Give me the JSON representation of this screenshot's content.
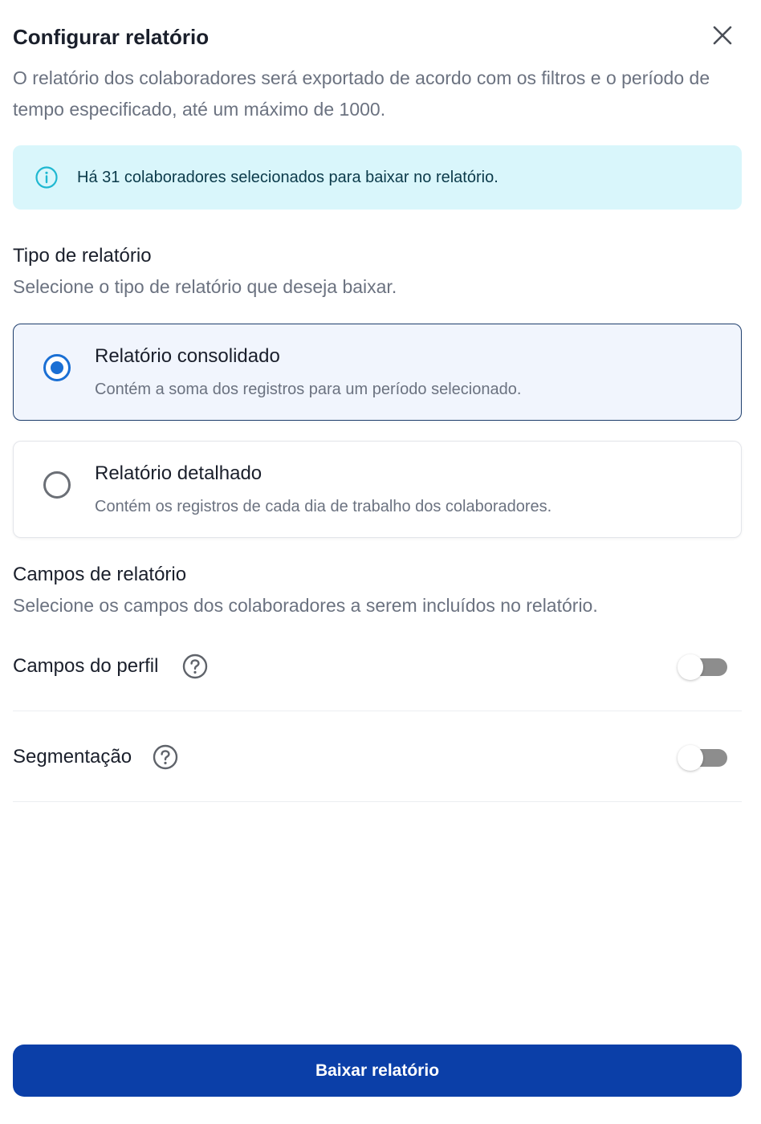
{
  "dialog": {
    "title": "Configurar relatório",
    "close_icon": "close-icon",
    "description": "O relatório dos colaboradores será exportado de acordo com os filtros e o período de tempo especificado, até um máximo de 1000."
  },
  "info_banner": {
    "icon": "info-icon",
    "text": "Há 31 colaboradores selecionados para baixar no relatório.",
    "background": "#d9f6fb",
    "icon_color": "#1fb8d1"
  },
  "report_type": {
    "title": "Tipo de relatório",
    "description": "Selecione o tipo de relatório que deseja baixar.",
    "options": [
      {
        "title": "Relatório consolidado",
        "description": "Contém a soma dos registros para um período selecionado.",
        "selected": true
      },
      {
        "title": "Relatório detalhado",
        "description": "Contém os registros de cada dia de trabalho dos colaboradores.",
        "selected": false
      }
    ]
  },
  "report_fields": {
    "title": "Campos de relatório",
    "description": "Selecione os campos dos colaboradores a serem incluídos no relatório.",
    "fields": [
      {
        "label": "Campos do perfil",
        "help_icon": "help-icon",
        "enabled": false
      },
      {
        "label": "Segmentação",
        "help_icon": "help-icon",
        "enabled": false
      }
    ]
  },
  "actions": {
    "download_label": "Baixar relatório",
    "primary_color": "#0b3fa8"
  },
  "colors": {
    "accent": "#1a6fd4",
    "text_primary": "#1a1f2b",
    "text_secondary": "#6b7280",
    "selected_border": "#1f3f6e",
    "selected_background": "#f1f5fd"
  }
}
